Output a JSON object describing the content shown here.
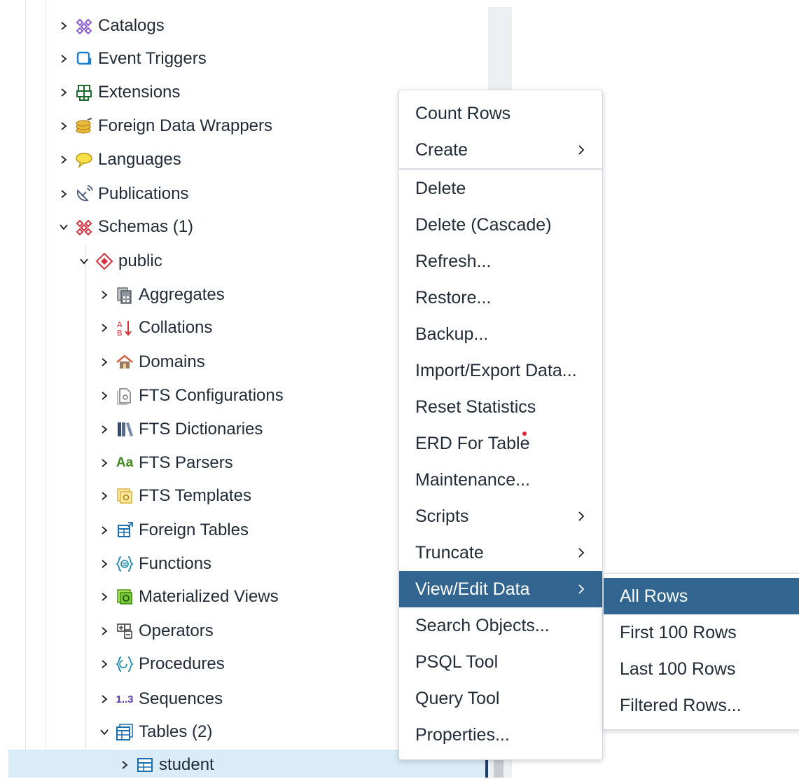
{
  "tree": {
    "items": [
      {
        "label": "Catalogs",
        "icon": "catalogs-icon",
        "state": "collapsed"
      },
      {
        "label": "Event Triggers",
        "icon": "event-triggers-icon",
        "state": "collapsed"
      },
      {
        "label": "Extensions",
        "icon": "extensions-icon",
        "state": "collapsed"
      },
      {
        "label": "Foreign Data Wrappers",
        "icon": "foreign-data-wrappers-icon",
        "state": "collapsed"
      },
      {
        "label": "Languages",
        "icon": "languages-icon",
        "state": "collapsed"
      },
      {
        "label": "Publications",
        "icon": "publications-icon",
        "state": "collapsed"
      },
      {
        "label": "Schemas (1)",
        "icon": "schemas-icon",
        "state": "expanded"
      },
      {
        "label": "public",
        "icon": "schema-public-icon",
        "state": "expanded"
      },
      {
        "label": "Aggregates",
        "icon": "aggregates-icon",
        "state": "collapsed"
      },
      {
        "label": "Collations",
        "icon": "collations-icon",
        "state": "collapsed"
      },
      {
        "label": "Domains",
        "icon": "domains-icon",
        "state": "collapsed"
      },
      {
        "label": "FTS Configurations",
        "icon": "fts-configurations-icon",
        "state": "collapsed"
      },
      {
        "label": "FTS Dictionaries",
        "icon": "fts-dictionaries-icon",
        "state": "collapsed"
      },
      {
        "label": "FTS Parsers",
        "icon": "fts-parsers-icon",
        "state": "collapsed",
        "icon_text": "Aa"
      },
      {
        "label": "FTS Templates",
        "icon": "fts-templates-icon",
        "state": "collapsed"
      },
      {
        "label": "Foreign Tables",
        "icon": "foreign-tables-icon",
        "state": "collapsed"
      },
      {
        "label": "Functions",
        "icon": "functions-icon",
        "state": "collapsed"
      },
      {
        "label": "Materialized Views",
        "icon": "materialized-views-icon",
        "state": "collapsed"
      },
      {
        "label": "Operators",
        "icon": "operators-icon",
        "state": "collapsed"
      },
      {
        "label": "Procedures",
        "icon": "procedures-icon",
        "state": "collapsed"
      },
      {
        "label": "Sequences",
        "icon": "sequences-icon",
        "state": "collapsed",
        "icon_text": "1..3"
      },
      {
        "label": "Tables (2)",
        "icon": "tables-icon",
        "state": "expanded"
      },
      {
        "label": "student",
        "icon": "table-icon",
        "state": "collapsed",
        "selected": true
      }
    ]
  },
  "context_menu": {
    "items": [
      {
        "label": "Count Rows"
      },
      {
        "label": "Create",
        "submenu": true
      },
      {
        "label": "Delete"
      },
      {
        "label": "Delete (Cascade)"
      },
      {
        "label": "Refresh..."
      },
      {
        "label": "Restore..."
      },
      {
        "label": "Backup..."
      },
      {
        "label": "Import/Export Data..."
      },
      {
        "label": "Reset Statistics"
      },
      {
        "label": "ERD For Table"
      },
      {
        "label": "Maintenance..."
      },
      {
        "label": "Scripts",
        "submenu": true
      },
      {
        "label": "Truncate",
        "submenu": true
      },
      {
        "label": "View/Edit Data",
        "submenu": true,
        "active": true
      },
      {
        "label": "Search Objects..."
      },
      {
        "label": "PSQL Tool"
      },
      {
        "label": "Query Tool"
      },
      {
        "label": "Properties..."
      }
    ]
  },
  "submenu": {
    "items": [
      {
        "label": "All Rows",
        "active": true
      },
      {
        "label": "First 100 Rows"
      },
      {
        "label": "Last 100 Rows"
      },
      {
        "label": "Filtered Rows..."
      }
    ]
  },
  "colors": {
    "active_bg": "#326690",
    "selected_row_bg": "#d9ecf8",
    "text": "#222b38"
  }
}
